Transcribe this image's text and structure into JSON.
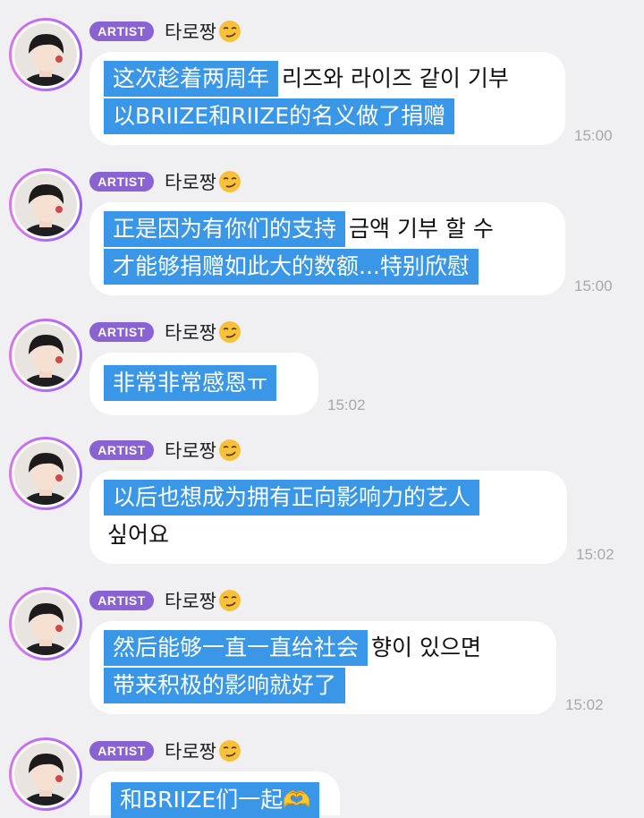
{
  "chat": {
    "badge_label": "ARTIST",
    "sender_name": "타로짱",
    "sender_emoji": "smirking-face-emoji",
    "messages": [
      {
        "lines": [
          {
            "hl": "这次趁着两周年",
            "ko": "리즈와 라이즈 같이 기부"
          },
          {
            "hl": "以BRIIZE和RIIZE的名义做了捐赠",
            "ko": ""
          }
        ],
        "time": "15:00"
      },
      {
        "lines": [
          {
            "hl": "正是因为有你们的支持",
            "ko": "금액 기부 할 수"
          },
          {
            "hl": "才能够捐赠如此大的数额...特别欣慰",
            "ko": ""
          }
        ],
        "time": "15:00"
      },
      {
        "lines": [
          {
            "hl": "非常非常感恩ㅠ",
            "ko": ""
          }
        ],
        "time": "15:02"
      },
      {
        "lines": [
          {
            "hl": "以后也想成为拥有正向影响力的艺人",
            "ko": ""
          },
          {
            "hl": "",
            "ko": "싶어요"
          }
        ],
        "time": "15:02"
      },
      {
        "lines": [
          {
            "hl": "然后能够一直一直给社会",
            "ko": "향이 있으면"
          },
          {
            "hl": "带来积极的影响就好了",
            "ko": ""
          }
        ],
        "time": "15:02"
      },
      {
        "lines": [
          {
            "hl": "和BRIIZE们一起🫶",
            "ko": ""
          }
        ],
        "time": ""
      }
    ]
  },
  "colors": {
    "background": "#f0f0f3",
    "badge": "#8a63d2",
    "highlight": "#3a96e6",
    "bubble": "#ffffff",
    "timestamp": "#a8a8ac"
  }
}
